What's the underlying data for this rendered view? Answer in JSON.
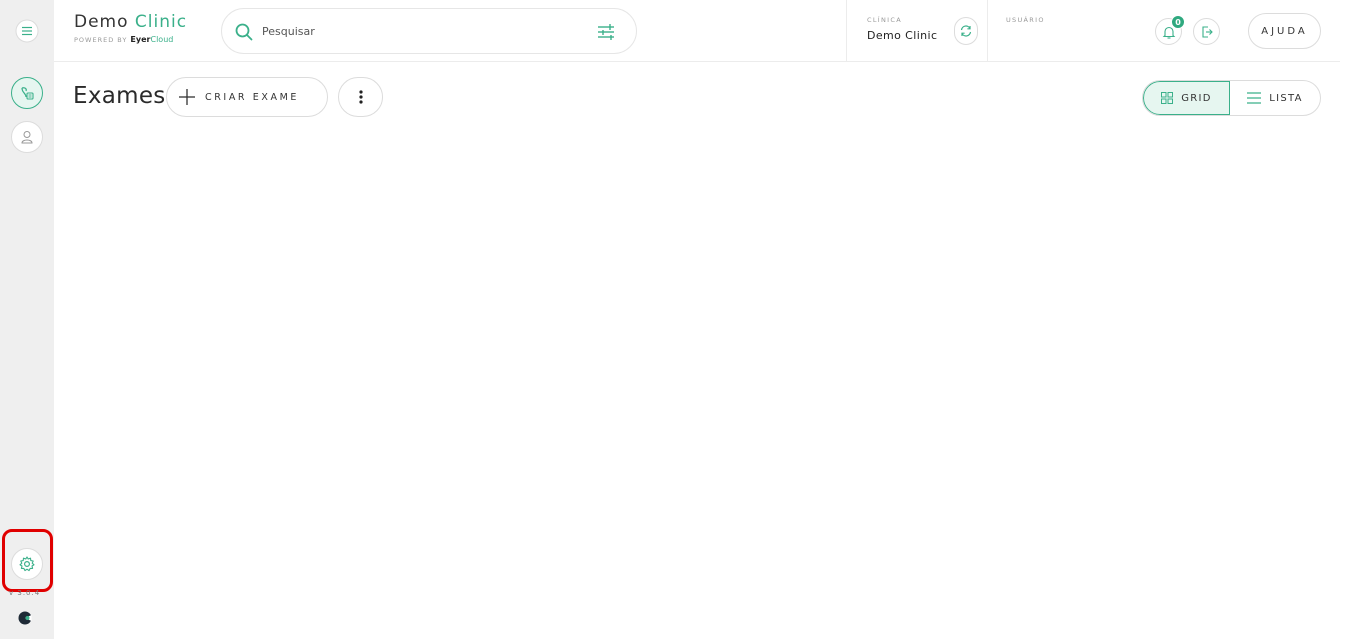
{
  "sidebar": {
    "menu_icon": "hamburger-icon",
    "items": [
      {
        "name": "exams",
        "icon": "exam-list-icon",
        "active": true
      },
      {
        "name": "patients",
        "icon": "user-icon",
        "active": false
      }
    ],
    "settings_icon": "gear-icon",
    "version": "v 3.0.4",
    "logo_icon": "eyercloud-logo-icon"
  },
  "header": {
    "brand": {
      "name_part1": "Demo",
      "name_part2": "Clinic",
      "powered_by": "POWERED BY",
      "brand_bold": "Eyer",
      "brand_accent": "Cloud"
    },
    "search": {
      "placeholder": "Pesquisar",
      "value": ""
    },
    "clinic": {
      "label": "CLÍNICA",
      "name": "Demo Clinic"
    },
    "user": {
      "label": "USUÁRIO",
      "name": ""
    },
    "notifications": {
      "count": "0"
    },
    "help_label": "AJUDA"
  },
  "main": {
    "title": "Exames",
    "create_label": "CRIAR EXAME",
    "view": {
      "grid_label": "GRID",
      "list_label": "LISTA",
      "selected": "grid"
    }
  },
  "colors": {
    "accent": "#3ab08a",
    "sidebar_bg": "#efefef",
    "highlight": "#e00000"
  }
}
